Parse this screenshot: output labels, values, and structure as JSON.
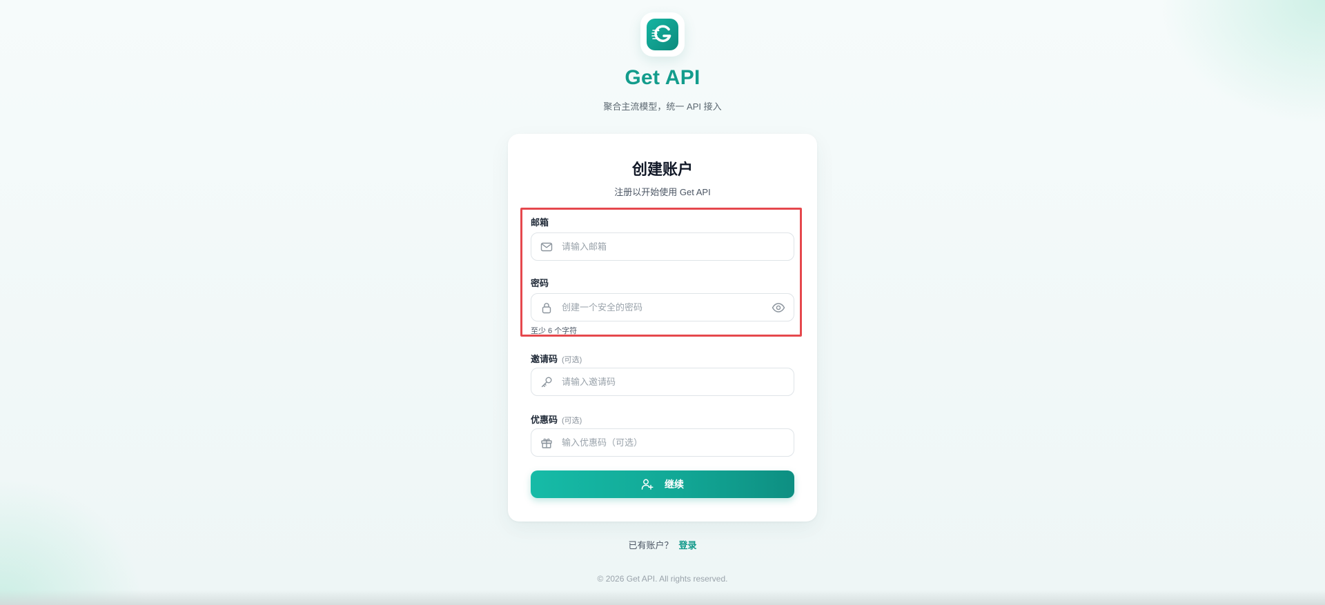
{
  "brand": {
    "name": "Get API",
    "tagline": "聚合主流模型，统一 API 接入",
    "accent_color": "#139c8c",
    "logo_icon": "get-api-logo-icon"
  },
  "form": {
    "title": "创建账户",
    "subtitle": "注册以开始使用 Get API",
    "fields": {
      "email": {
        "label": "邮箱",
        "placeholder": "请输入邮箱",
        "value": "",
        "icon": "mail-icon"
      },
      "password": {
        "label": "密码",
        "placeholder": "创建一个安全的密码",
        "value": "",
        "icon": "lock-icon",
        "toggle_icon": "eye-icon",
        "hint": "至少 6 个字符"
      },
      "invite_code": {
        "label": "邀请码",
        "optional_tag": "(可选)",
        "placeholder": "请输入邀请码",
        "value": "",
        "icon": "key-icon"
      },
      "coupon_code": {
        "label": "优惠码",
        "optional_tag": "(可选)",
        "placeholder": "输入优惠码（可选）",
        "value": "",
        "icon": "gift-icon"
      }
    },
    "submit": {
      "label": "继续",
      "icon": "user-plus-icon"
    },
    "highlight_color": "#e5484d"
  },
  "login_prompt": {
    "text": "已有账户？",
    "link_label": "登录"
  },
  "footer": {
    "copyright": "© 2026 Get API. All rights reserved."
  }
}
